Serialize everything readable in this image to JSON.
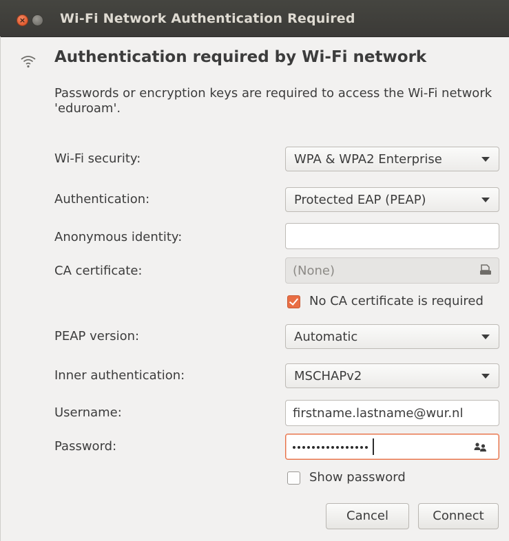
{
  "window": {
    "title": "Wi-Fi Network Authentication Required",
    "close_glyph": "×"
  },
  "header": {
    "icon": "wifi-icon",
    "heading": "Authentication required by Wi-Fi network",
    "description": "Passwords or encryption keys are required to access the Wi-Fi network 'eduroam'."
  },
  "form": {
    "wifi_security": {
      "label": "Wi-Fi security:",
      "value": "WPA & WPA2 Enterprise"
    },
    "authentication": {
      "label": "Authentication:",
      "value": "Protected EAP (PEAP)"
    },
    "anonymous_identity": {
      "label": "Anonymous identity:",
      "value": ""
    },
    "ca_certificate": {
      "label": "CA certificate:",
      "value": "(None)",
      "icon": "file-icon"
    },
    "no_ca_required": {
      "label": "No CA certificate is required",
      "checked": true
    },
    "peap_version": {
      "label": "PEAP version:",
      "value": "Automatic"
    },
    "inner_authentication": {
      "label": "Inner authentication:",
      "value": "MSCHAPv2"
    },
    "username": {
      "label": "Username:",
      "value": "firstname.lastname@wur.nl"
    },
    "password": {
      "label": "Password:",
      "masked_length": 16,
      "icon": "people-icon"
    },
    "show_password": {
      "label": "Show password",
      "checked": false
    }
  },
  "buttons": {
    "cancel": "Cancel",
    "connect": "Connect"
  },
  "colors": {
    "accent": "#e96e44",
    "titlebar": "#3c3b37",
    "background": "#f2f1f0"
  }
}
